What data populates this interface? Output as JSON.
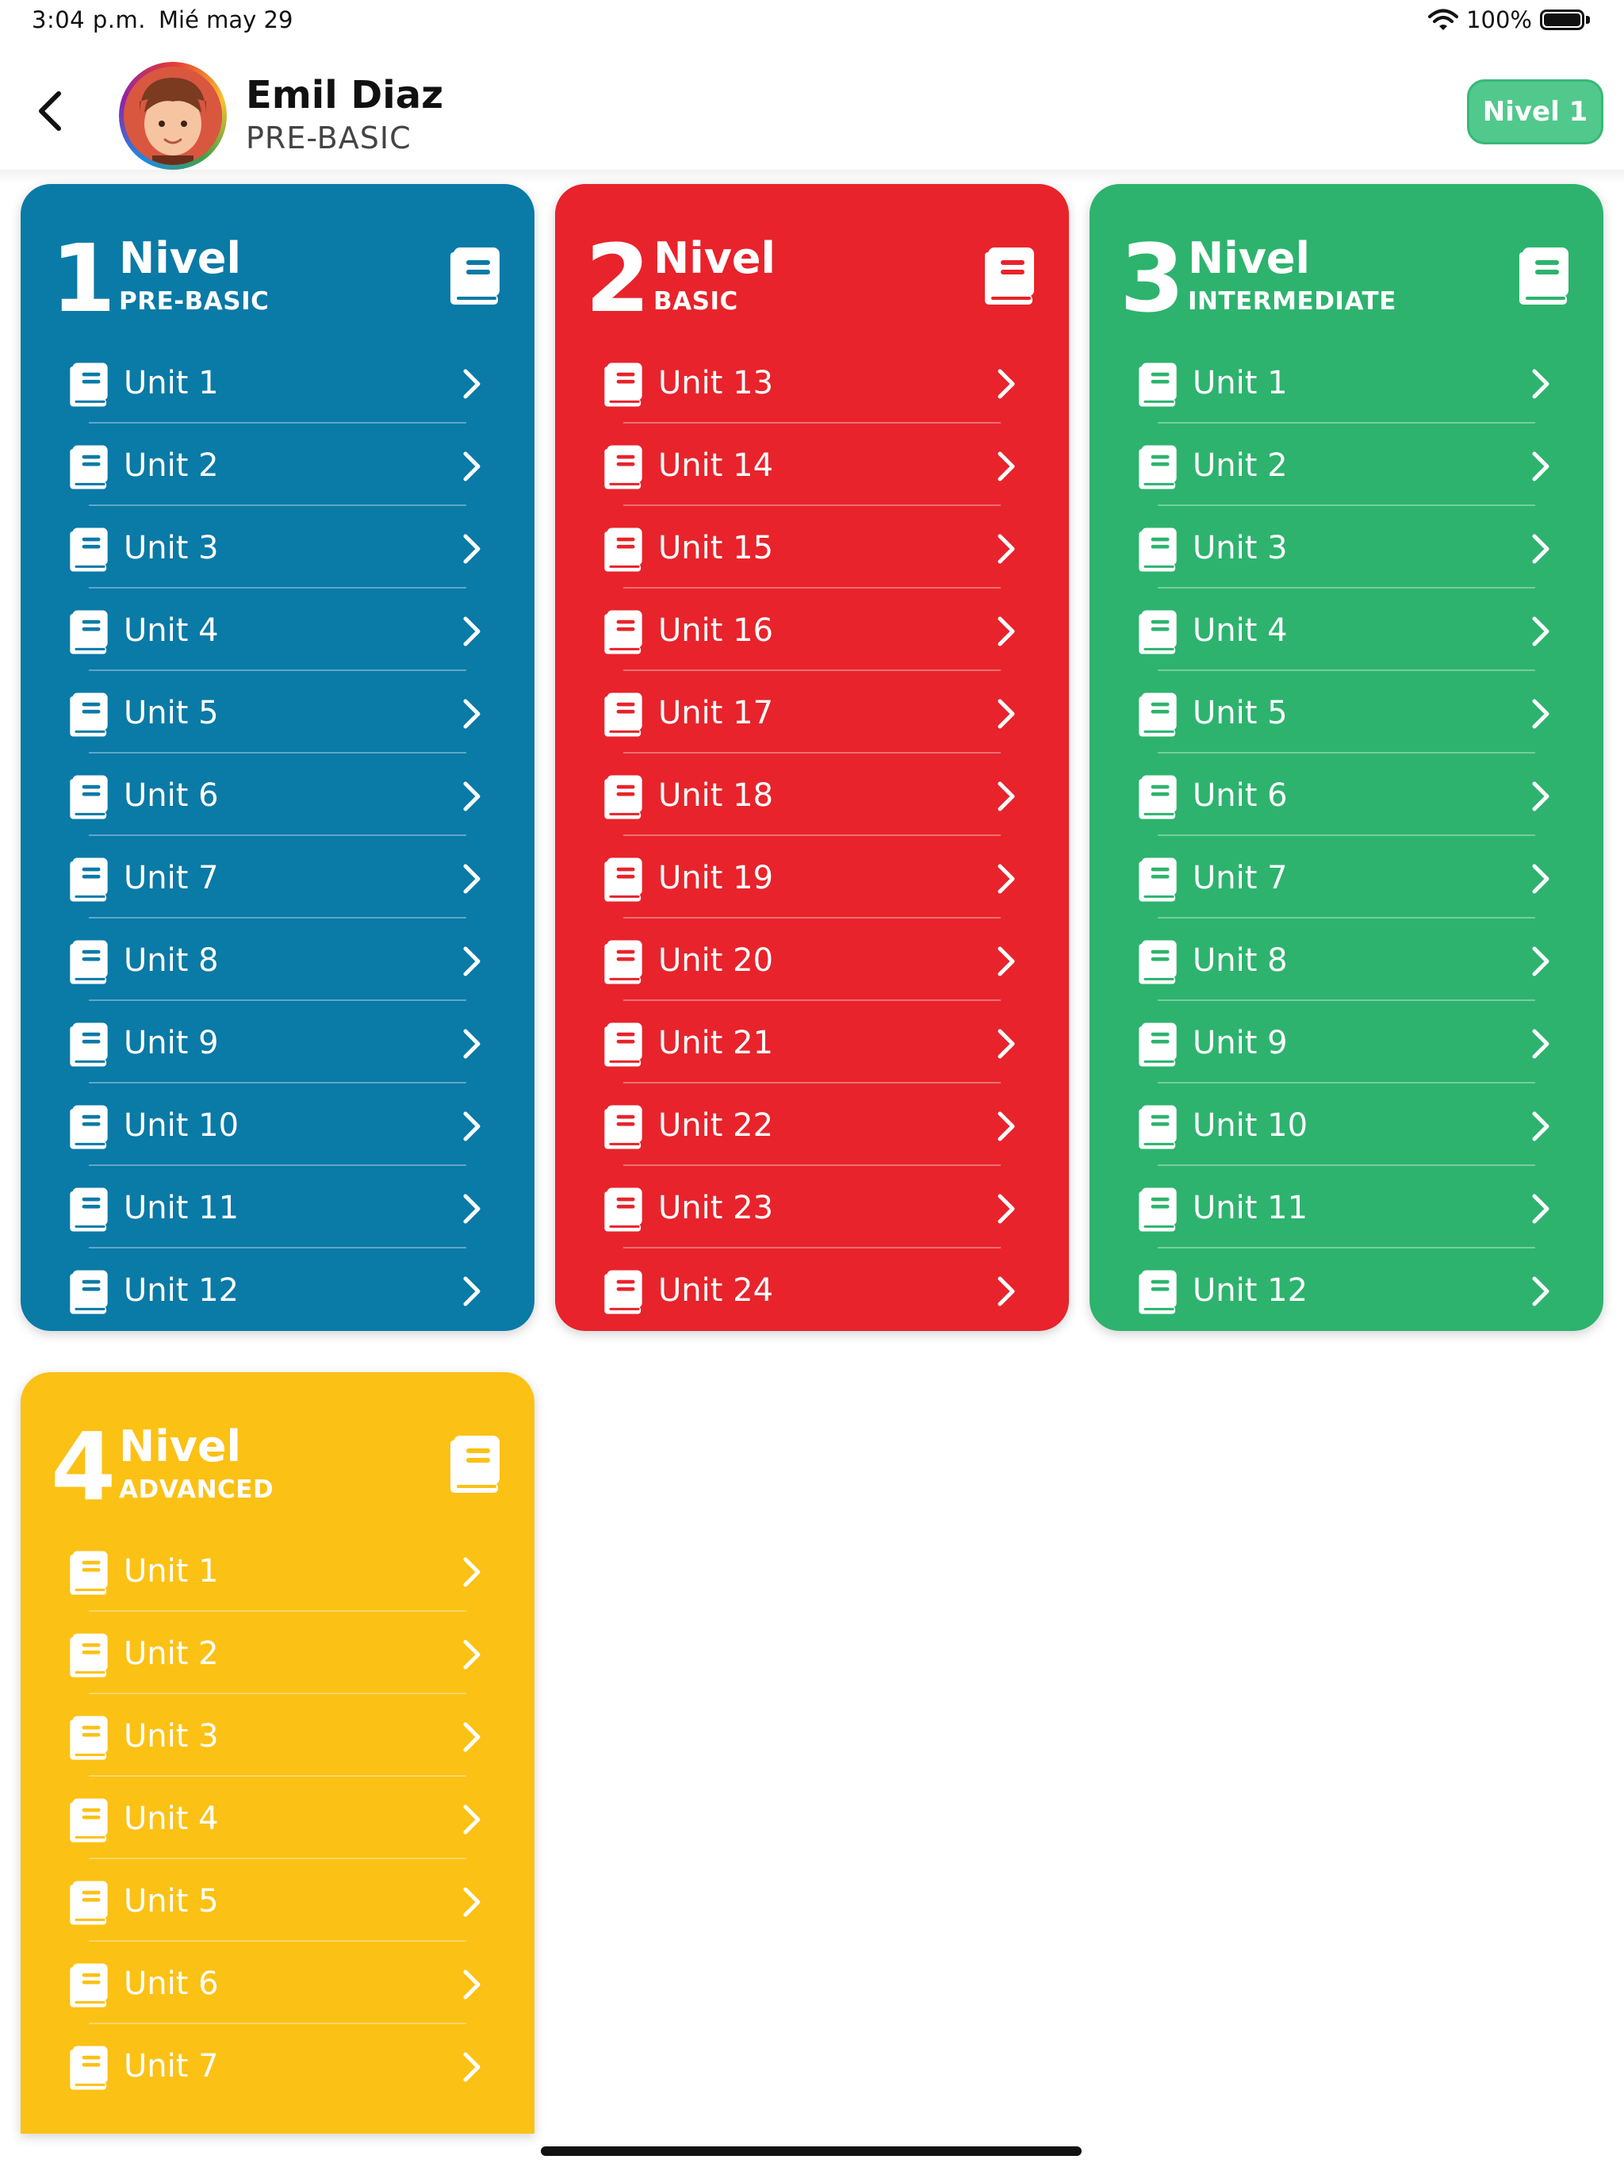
{
  "status_bar": {
    "time": "3:04 p.m.",
    "date": "Mié may 29",
    "battery": "100%"
  },
  "header": {
    "user_name": "Emil Diaz",
    "user_level": "PRE-BASIC",
    "badge_label": "Nivel 1"
  },
  "cards": [
    {
      "number": "1",
      "title": "Nivel",
      "subtitle": "PRE-BASIC",
      "color": "#0a7aa6",
      "units": [
        "Unit 1",
        "Unit 2",
        "Unit 3",
        "Unit 4",
        "Unit 5",
        "Unit 6",
        "Unit 7",
        "Unit 8",
        "Unit 9",
        "Unit 10",
        "Unit 11",
        "Unit 12"
      ]
    },
    {
      "number": "2",
      "title": "Nivel",
      "subtitle": "BASIC",
      "color": "#e8232b",
      "units": [
        "Unit 13",
        "Unit 14",
        "Unit 15",
        "Unit 16",
        "Unit 17",
        "Unit 18",
        "Unit 19",
        "Unit 20",
        "Unit 21",
        "Unit 22",
        "Unit 23",
        "Unit 24"
      ]
    },
    {
      "number": "3",
      "title": "Nivel",
      "subtitle": "INTERMEDIATE",
      "color": "#2db36e",
      "units": [
        "Unit 1",
        "Unit 2",
        "Unit 3",
        "Unit 4",
        "Unit 5",
        "Unit 6",
        "Unit 7",
        "Unit 8",
        "Unit 9",
        "Unit 10",
        "Unit 11",
        "Unit 12"
      ]
    },
    {
      "number": "4",
      "title": "Nivel",
      "subtitle": "ADVANCED",
      "color": "#fcc115",
      "units": [
        "Unit 1",
        "Unit 2",
        "Unit 3",
        "Unit 4",
        "Unit 5",
        "Unit 6",
        "Unit 7"
      ]
    }
  ],
  "icons": {
    "back": "chevron-left-icon",
    "book": "book-icon",
    "chevron": "chevron-right-icon",
    "wifi": "wifi-icon",
    "battery": "battery-icon"
  }
}
